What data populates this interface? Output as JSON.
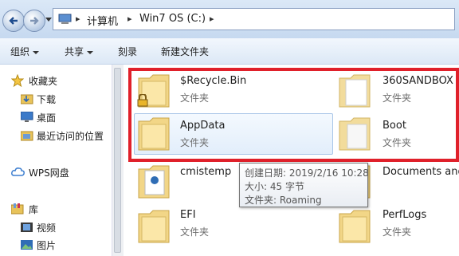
{
  "address_bar": {
    "breadcrumbs": [
      "计算机",
      "Win7 OS (C:)"
    ]
  },
  "toolbar": {
    "organize": "组织",
    "share": "共享",
    "burn": "刻录",
    "new_folder": "新建文件夹"
  },
  "nav_pane": {
    "favorites": "收藏夹",
    "downloads": "下载",
    "desktop": "桌面",
    "recent": "最近访问的位置",
    "wps_cloud": "WPS网盘",
    "libraries": "库",
    "videos": "视频",
    "pictures": "图片"
  },
  "files": [
    {
      "name": "$Recycle.Bin",
      "type": "文件夹"
    },
    {
      "name": "360SANDBOX",
      "type": "文件夹"
    },
    {
      "name": "AppData",
      "type": "文件夹"
    },
    {
      "name": "Boot",
      "type": "文件夹"
    },
    {
      "name": "cmistemp",
      "type": ""
    },
    {
      "name": "Documents and",
      "type": ""
    },
    {
      "name": "EFI",
      "type": "文件夹"
    },
    {
      "name": "PerfLogs",
      "type": "文件夹"
    }
  ],
  "tooltip": {
    "created": "创建日期: 2019/2/16 10:28",
    "size": "大小: 45 字节",
    "folder": "文件夹: Roaming"
  },
  "colors": {
    "highlight_border": "#e0202a",
    "selection_fill": "#e2eefb"
  }
}
